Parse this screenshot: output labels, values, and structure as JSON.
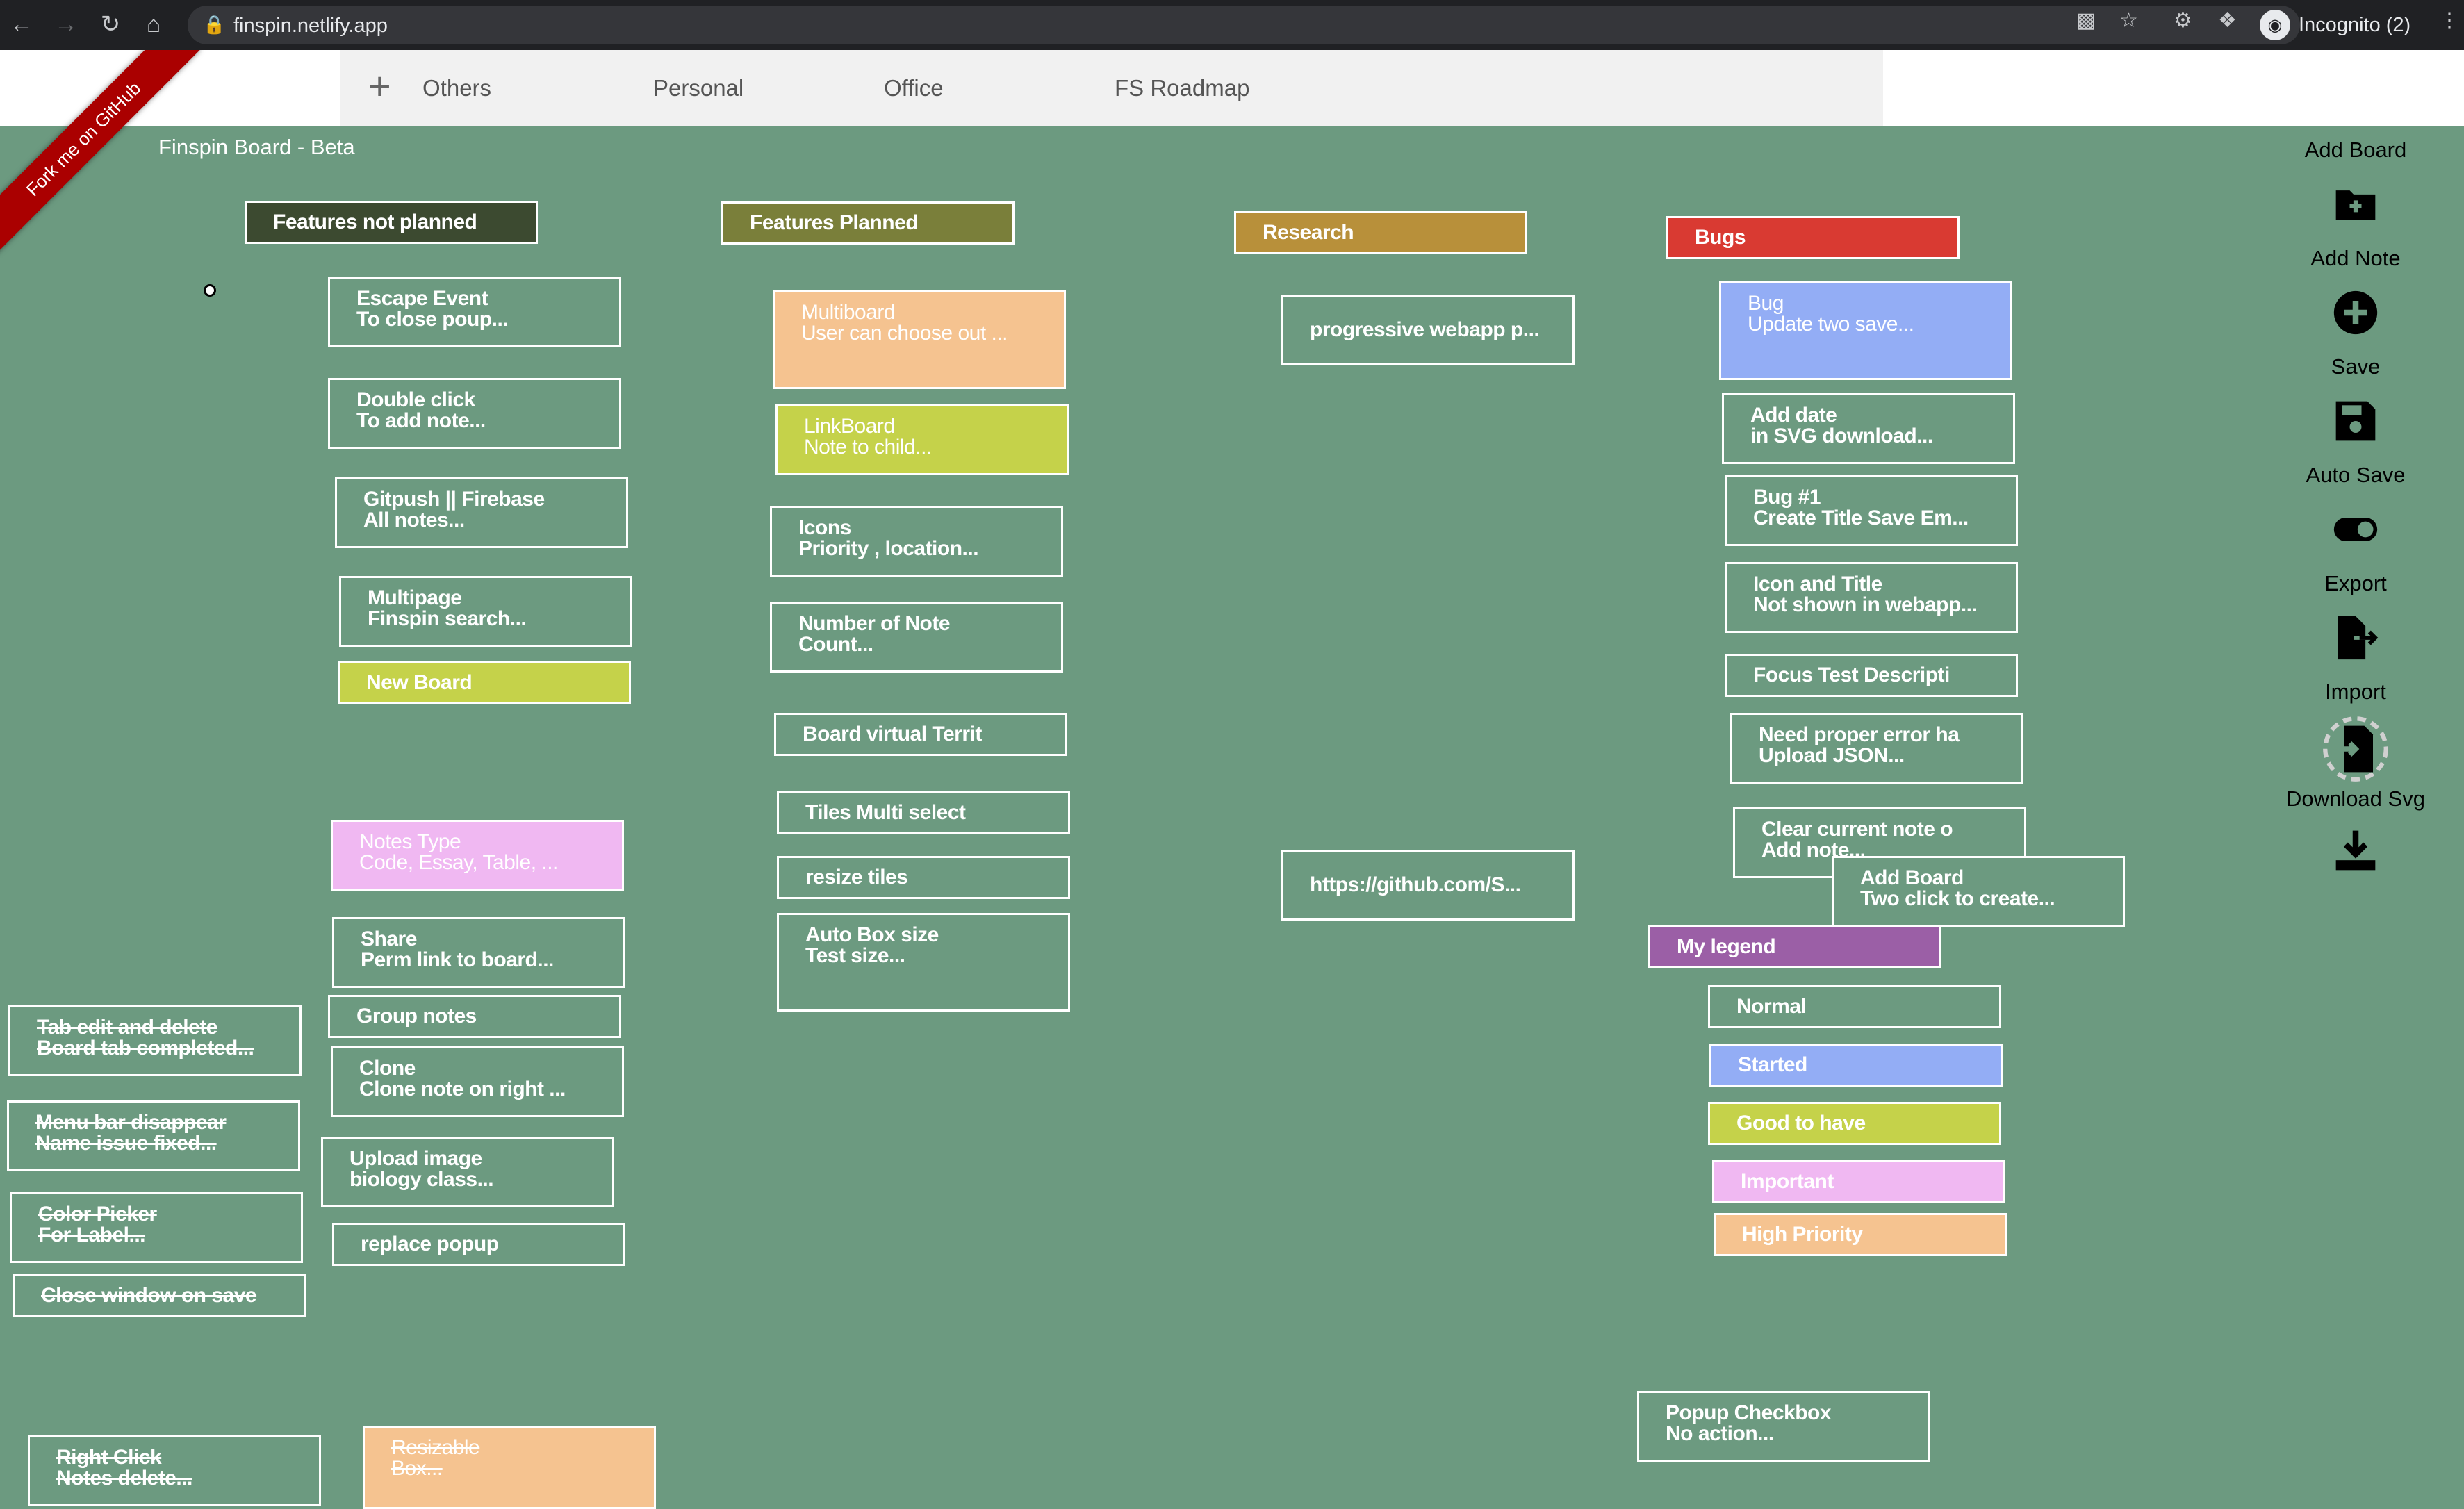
{
  "browser": {
    "url": "finspin.netlify.app",
    "profile_label": "Incognito (2)"
  },
  "tabs": [
    {
      "label": "Others"
    },
    {
      "label": "Personal"
    },
    {
      "label": "Office"
    },
    {
      "label": "FS Roadmap"
    }
  ],
  "ribbon_text": "Fork me on GitHub",
  "board_title": "Finspin Board - Beta",
  "colors": {
    "board_bg": "#6c9a80",
    "header_features_not_planned": "#3c4a30",
    "header_features_planned": "#7a7f3a",
    "header_research": "#b8903a",
    "header_bugs": "#d93a32",
    "header_legend": "#9b5fa6",
    "started": "#93adf5",
    "good_to_have": "#c5d24a",
    "important": "#f0b8f2",
    "high_priority": "#f5c390"
  },
  "notes": [
    {
      "title": "Features not planned",
      "subtitle": ""
    },
    {
      "title": "Escape Event",
      "subtitle": "To close poup..."
    },
    {
      "title": "Double click",
      "subtitle": "To add note..."
    },
    {
      "title": "Gitpush || Firebase",
      "subtitle": "All notes..."
    },
    {
      "title": "Multipage",
      "subtitle": "Finspin search..."
    },
    {
      "title": "New Board",
      "subtitle": ""
    },
    {
      "title": "Notes Type",
      "subtitle": "Code, Essay, Table, ..."
    },
    {
      "title": "Share",
      "subtitle": "Perm link to board..."
    },
    {
      "title": "Group notes",
      "subtitle": ""
    },
    {
      "title": "Clone",
      "subtitle": "Clone note on right ..."
    },
    {
      "title": "Upload image",
      "subtitle": "biology class..."
    },
    {
      "title": "replace popup",
      "subtitle": ""
    },
    {
      "title": "Tab edit and delete",
      "subtitle": "Board tab completed..."
    },
    {
      "title": "Menu bar disappear",
      "subtitle": "Name issue fixed..."
    },
    {
      "title": "Color Picker",
      "subtitle": "For Label..."
    },
    {
      "title": "Close window on save",
      "subtitle": ""
    },
    {
      "title": "Right Click",
      "subtitle": "Notes delete..."
    },
    {
      "title": "Resizable",
      "subtitle": "Box..."
    },
    {
      "title": "Features Planned",
      "subtitle": ""
    },
    {
      "title": "Multiboard",
      "subtitle": "User can choose out ..."
    },
    {
      "title": "LinkBoard",
      "subtitle": "Note to child..."
    },
    {
      "title": "Icons",
      "subtitle": "Priority , location..."
    },
    {
      "title": "Number of Note",
      "subtitle": "Count..."
    },
    {
      "title": "Board virtual Territ",
      "subtitle": ""
    },
    {
      "title": "Tiles Multi select",
      "subtitle": ""
    },
    {
      "title": "resize tiles",
      "subtitle": ""
    },
    {
      "title": "Auto Box size",
      "subtitle": "Test size..."
    },
    {
      "title": "Research",
      "subtitle": ""
    },
    {
      "title": "progressive webapp p...",
      "subtitle": ""
    },
    {
      "title": "https://github.com/S...",
      "subtitle": ""
    },
    {
      "title": "Bugs",
      "subtitle": ""
    },
    {
      "title": "Bug",
      "subtitle": "Update two save..."
    },
    {
      "title": "Add date",
      "subtitle": "in SVG download..."
    },
    {
      "title": "Bug #1",
      "subtitle": "Create Title Save Em..."
    },
    {
      "title": "Icon and Title",
      "subtitle": "Not shown in webapp..."
    },
    {
      "title": "Focus Test Descripti",
      "subtitle": ""
    },
    {
      "title": "Need proper error ha",
      "subtitle": "Upload JSON..."
    },
    {
      "title": "Clear current note o",
      "subtitle": "Add note..."
    },
    {
      "title": "Add Board",
      "subtitle": "Two click to create..."
    },
    {
      "title": "My legend",
      "subtitle": ""
    },
    {
      "title": "Normal",
      "subtitle": ""
    },
    {
      "title": "Started",
      "subtitle": ""
    },
    {
      "title": "Good to have",
      "subtitle": ""
    },
    {
      "title": "Important",
      "subtitle": ""
    },
    {
      "title": "High Priority",
      "subtitle": ""
    },
    {
      "title": "Popup Checkbox",
      "subtitle": "No action..."
    }
  ],
  "toolbar": [
    {
      "label": "Add Board",
      "icon": "folder-plus-icon"
    },
    {
      "label": "Add Note",
      "icon": "plus-circle-icon"
    },
    {
      "label": "Save",
      "icon": "floppy-disk-icon"
    },
    {
      "label": "Auto Save",
      "icon": "toggle-icon"
    },
    {
      "label": "Export",
      "icon": "file-export-icon"
    },
    {
      "label": "Import",
      "icon": "file-import-icon"
    },
    {
      "label": "Download Svg",
      "icon": "download-icon"
    }
  ]
}
